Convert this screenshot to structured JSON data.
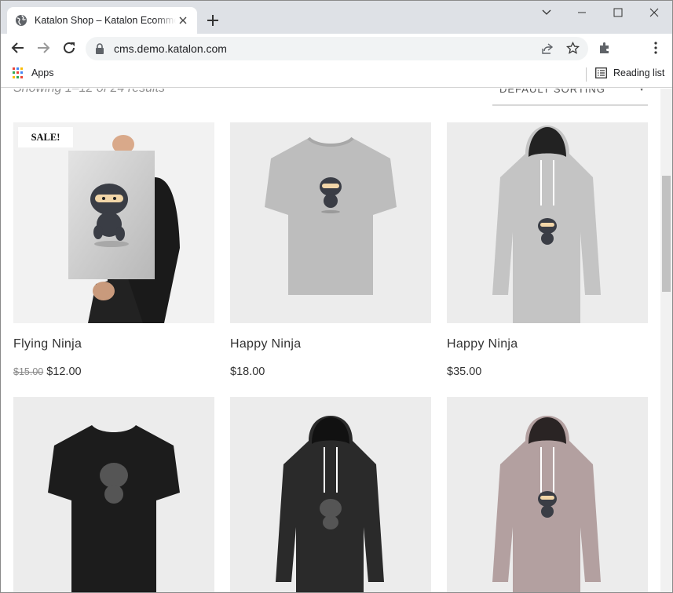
{
  "browser": {
    "tab_title": "Katalon Shop – Katalon Ecommerce",
    "url": "cms.demo.katalon.com",
    "bookmarks": {
      "apps_label": "Apps",
      "reading_list_label": "Reading list"
    },
    "icons": [
      "globe-icon",
      "close-icon",
      "plus-icon",
      "chevron-down-icon",
      "minimize-icon",
      "maximize-icon",
      "close-window-icon",
      "back-icon",
      "forward-icon",
      "reload-icon",
      "lock-icon",
      "share-icon",
      "star-icon",
      "extensions-icon",
      "more-icon",
      "apps-grid-icon",
      "reading-list-icon"
    ]
  },
  "shop": {
    "result_count": "Showing 1–12 of 24 results",
    "sorting": "DEFAULT SORTING",
    "sale_badge": "SALE!",
    "products": [
      {
        "name": "Flying Ninja",
        "old_price": "$15.00",
        "price": "$12.00",
        "image": "poster-ninja"
      },
      {
        "name": "Happy Ninja",
        "price": "$18.00",
        "image": "tshirt-grey"
      },
      {
        "name": "Happy Ninja",
        "price": "$35.00",
        "image": "hoodie-grey"
      },
      {
        "image": "tshirt-black"
      },
      {
        "image": "hoodie-black"
      },
      {
        "image": "hoodie-pink"
      }
    ]
  }
}
